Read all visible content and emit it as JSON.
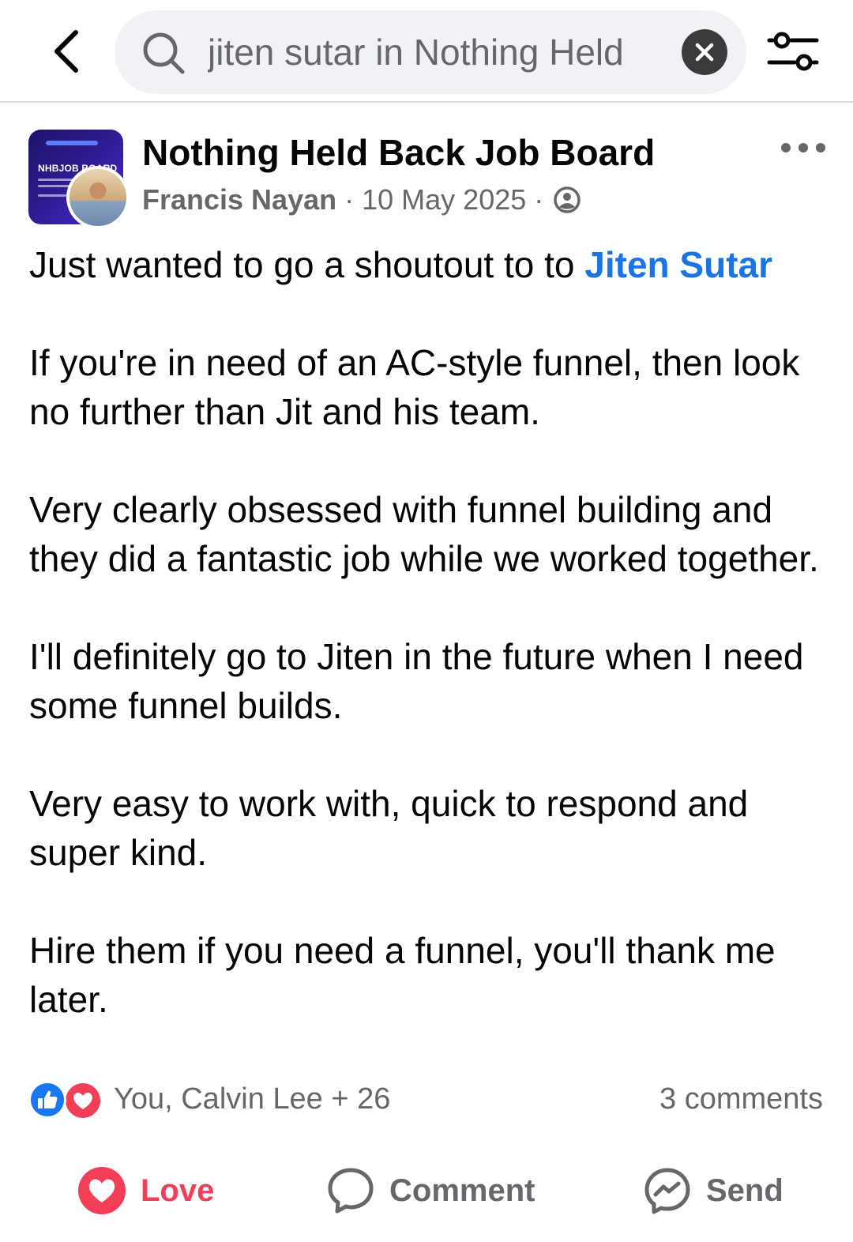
{
  "search": {
    "query": "jiten sutar in Nothing Held"
  },
  "post": {
    "group_name": "Nothing Held Back Job Board",
    "author": "Francis Nayan",
    "separator": "·",
    "date": "10 May 2025",
    "avatar_text": "NHBJOB BOARD",
    "body": {
      "intro": "Just wanted to go a shoutout to to ",
      "mention": "Jiten Sutar",
      "paragraphs": [
        "If you're in need of an AC-style funnel, then look no further than Jit and his team.",
        "Very clearly obsessed with funnel building and they did a fantastic job while we worked together.",
        "I'll definitely go to Jiten in the future when I need some funnel builds.",
        "Very easy to work with, quick to respond and super kind.",
        "Hire them if you need a funnel, you'll thank me later."
      ]
    },
    "reactions": {
      "summary": "You, Calvin Lee + 26",
      "comments": "3 comments"
    },
    "actions": {
      "love": "Love",
      "comment": "Comment",
      "send": "Send"
    }
  },
  "icons": {
    "back": "back-arrow-icon",
    "search": "search-icon",
    "clear": "clear-icon",
    "filter": "filter-icon",
    "more": "more-options-icon",
    "privacy": "members-only-icon",
    "like": "like-reaction-icon",
    "love_reaction": "love-reaction-icon",
    "love": "heart-icon",
    "comment": "comment-bubble-icon",
    "send": "messenger-icon"
  },
  "colors": {
    "link": "#1b74e4",
    "love": "#f33e58",
    "like": "#1877f2",
    "secondary_text": "#65676b",
    "search_bg": "#f0f2f5"
  }
}
